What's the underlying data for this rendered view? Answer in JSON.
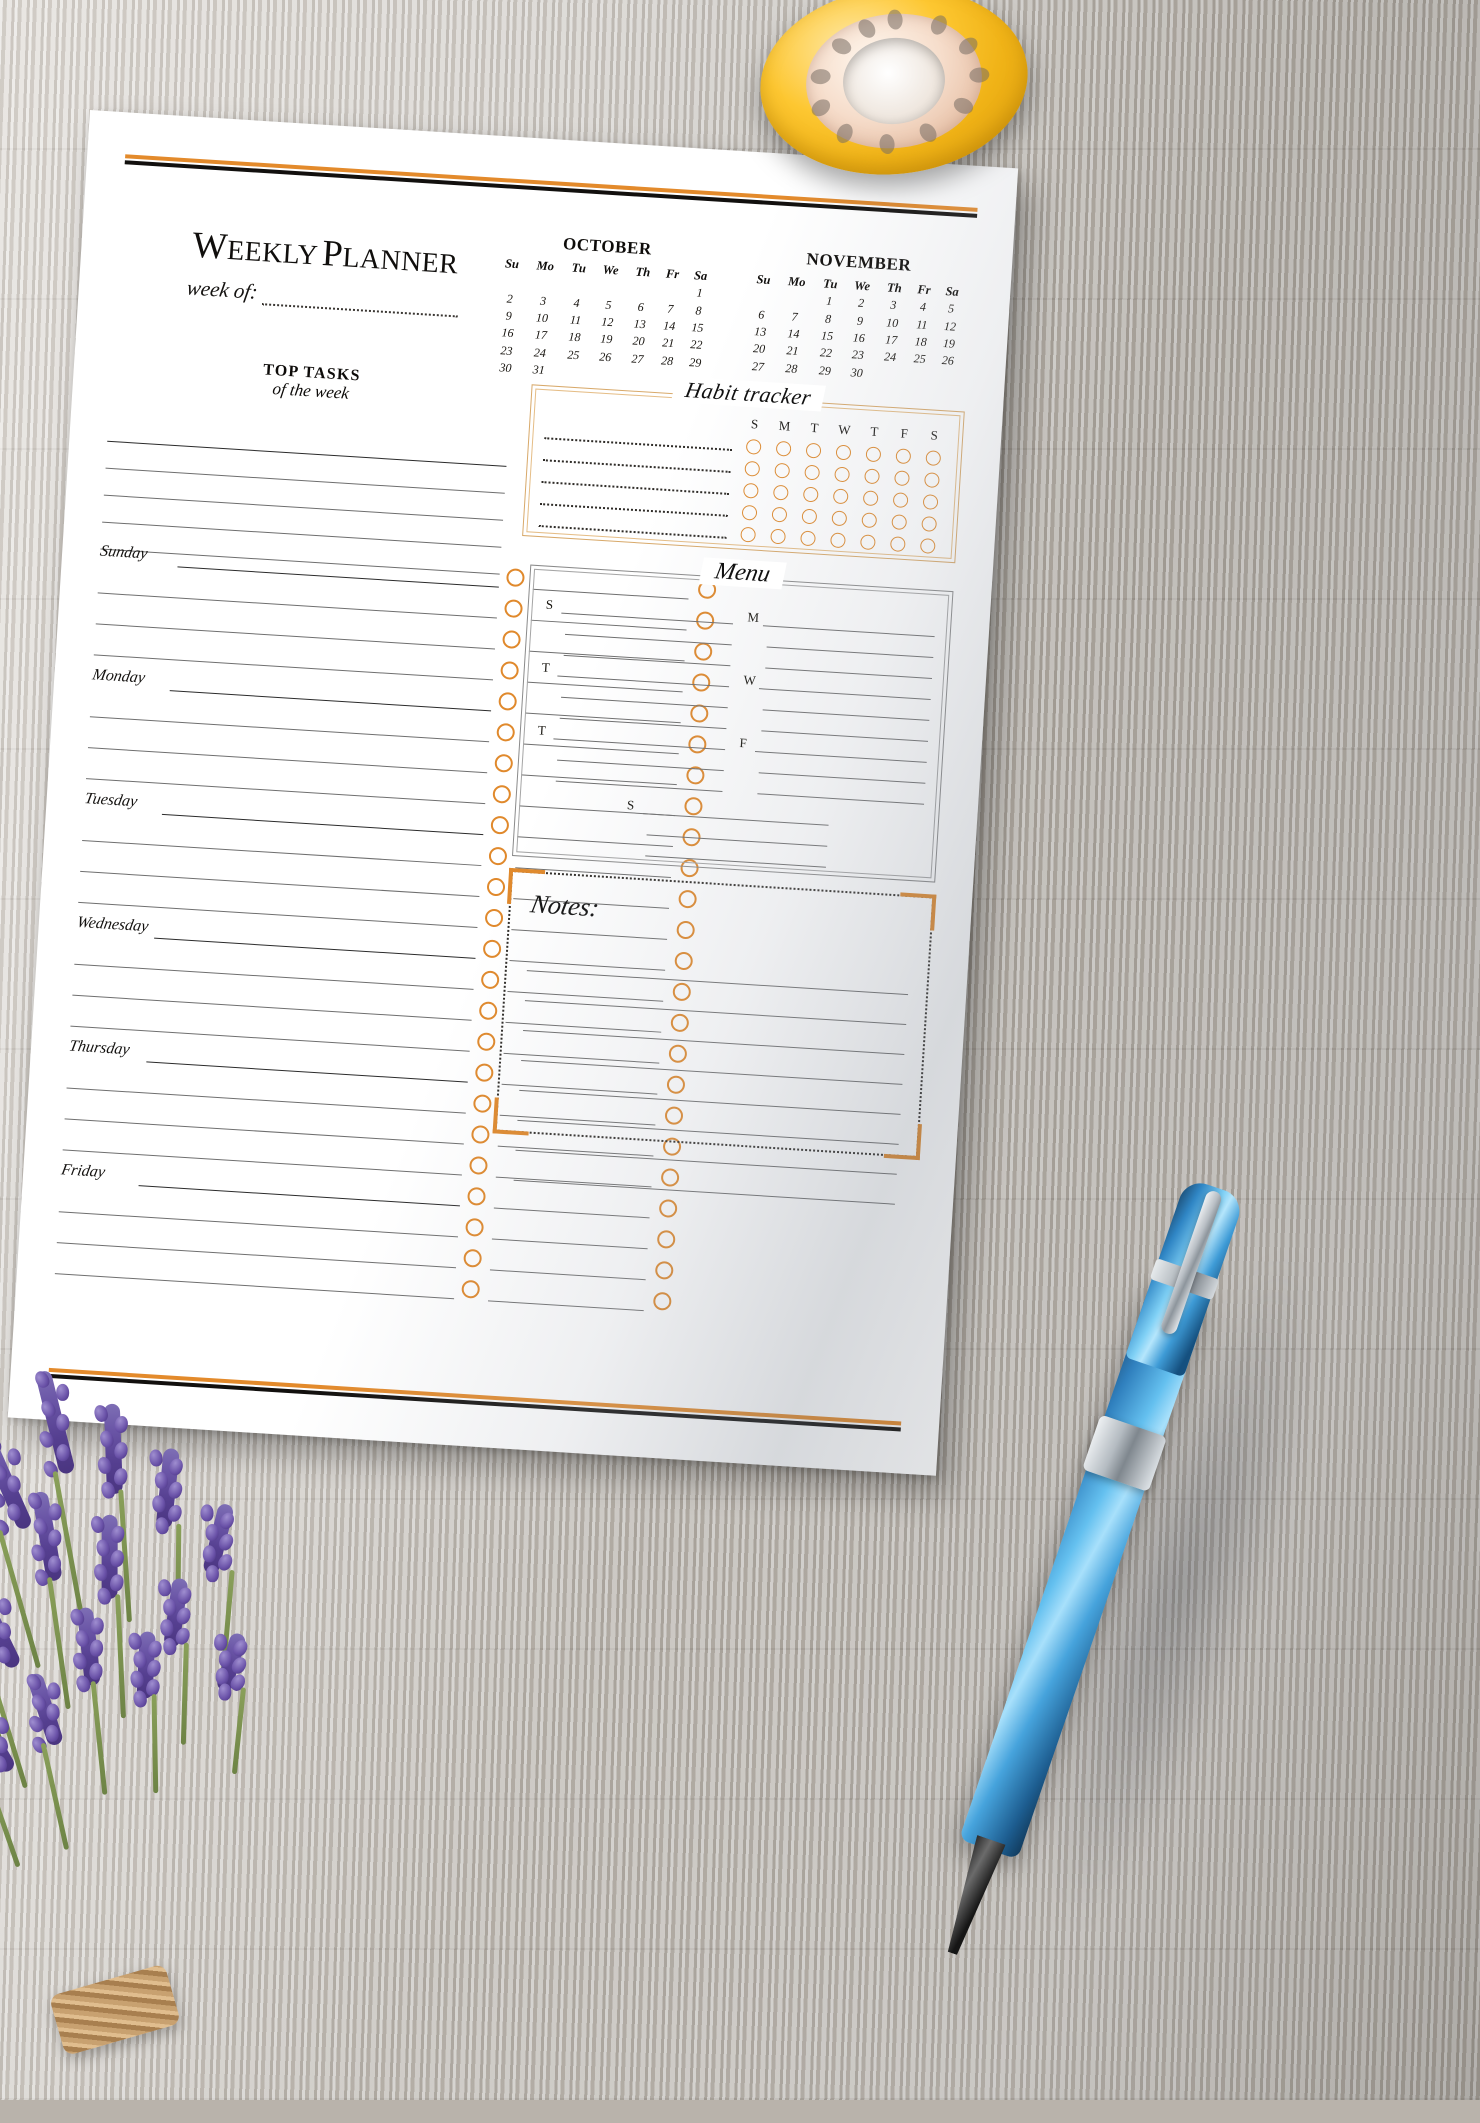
{
  "document": {
    "title_word1": "W",
    "title_word1_rest": "EEKLY",
    "title_word2": "P",
    "title_word2_rest": "LANNER",
    "week_of_label": "week of:"
  },
  "colors": {
    "accent_orange": "#e0892c",
    "rule_black": "#12100e",
    "habit_border": "#d8a96a",
    "menu_border": "#8a8a8a",
    "line_gray": "#6f6f6f"
  },
  "calendars": [
    {
      "name": "OCTOBER",
      "weekday_headers": [
        "Su",
        "Mo",
        "Tu",
        "We",
        "Th",
        "Fr",
        "Sa"
      ],
      "weeks": [
        [
          "",
          "",
          "",
          "",
          "",
          "",
          "1"
        ],
        [
          "2",
          "3",
          "4",
          "5",
          "6",
          "7",
          "8"
        ],
        [
          "9",
          "10",
          "11",
          "12",
          "13",
          "14",
          "15"
        ],
        [
          "16",
          "17",
          "18",
          "19",
          "20",
          "21",
          "22"
        ],
        [
          "23",
          "24",
          "25",
          "26",
          "27",
          "28",
          "29"
        ],
        [
          "30",
          "31",
          "",
          "",
          "",
          "",
          ""
        ]
      ]
    },
    {
      "name": "NOVEMBER",
      "weekday_headers": [
        "Su",
        "Mo",
        "Tu",
        "We",
        "Th",
        "Fr",
        "Sa"
      ],
      "weeks": [
        [
          "",
          "",
          "1",
          "2",
          "3",
          "4",
          "5"
        ],
        [
          "6",
          "7",
          "8",
          "9",
          "10",
          "11",
          "12"
        ],
        [
          "13",
          "14",
          "15",
          "16",
          "17",
          "18",
          "19"
        ],
        [
          "20",
          "21",
          "22",
          "23",
          "24",
          "25",
          "26"
        ],
        [
          "27",
          "28",
          "29",
          "30",
          "",
          "",
          ""
        ]
      ]
    }
  ],
  "top_tasks": {
    "heading_line1": "TOP TASKS",
    "heading_line2": "of the week",
    "line_count": 5
  },
  "habit_tracker": {
    "title": "Habit tracker",
    "day_headers": [
      "S",
      "M",
      "T",
      "W",
      "T",
      "F",
      "S"
    ],
    "row_count": 5
  },
  "day_planner": {
    "days": [
      "Sunday",
      "Monday",
      "Tuesday",
      "Wednesday",
      "Thursday",
      "Friday"
    ],
    "lines_per_day": 4,
    "columns": 2
  },
  "menu": {
    "title": "Menu",
    "pairs": [
      {
        "left": "S",
        "right": "M"
      },
      {
        "left": "T",
        "right": "W"
      },
      {
        "left": "T",
        "right": "F"
      }
    ],
    "solo": "S",
    "sub_lines_per_entry": 2
  },
  "notes": {
    "title": "Notes:",
    "line_count": 8
  }
}
